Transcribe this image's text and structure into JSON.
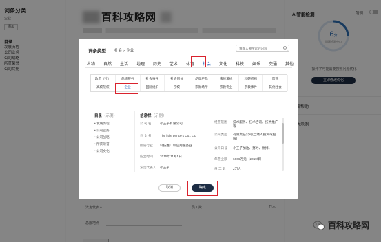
{
  "left_panel": {
    "title": "词条分类",
    "subtitle": "企业",
    "button": "添加",
    "section": "目录",
    "items": [
      "发展历程",
      "公司业务",
      "公司战略",
      "所获荣誉",
      "公司文化"
    ]
  },
  "page": {
    "brand": "百科攻略网"
  },
  "form": {
    "label_rep": "法定代表人",
    "label_emp": "员工数",
    "unit": "万人",
    "label_addr": "总部地点"
  },
  "right_panel": {
    "title": "AI智能检测",
    "sample_label": "范例",
    "score": "6",
    "score_unit": "分",
    "score_caption": "问题检测中心",
    "note": "操作了可能需要按照问题优化",
    "button": "立即修改优化",
    "section1": "编辑帮助",
    "section2": "优秀示例"
  },
  "modal": {
    "title": "词条类型",
    "breadcrumb": "社会 > 企业",
    "search_placeholder": "请输入要搜索的内容",
    "tabs": [
      "人物",
      "自然",
      "生活",
      "地理",
      "历史",
      "艺术",
      "体育",
      "社会",
      "文化",
      "科技",
      "娱乐",
      "交通",
      "其他"
    ],
    "active_tab": "社会",
    "categories": [
      [
        "政府（社）",
        "品牌服务",
        "社会事件",
        "社会团体",
        "品牌产品",
        "法律法规",
        "科研机构",
        "医院"
      ],
      [
        "高校院校",
        "企业",
        "国际组织",
        "学校",
        "宗教场所",
        "宗教专业",
        "宗教事件",
        "其他社会"
      ]
    ],
    "selected_category": "企业",
    "preview": {
      "toc_title": "目录",
      "toc_hint": "（示例）",
      "toc_items": [
        "发展历程",
        "公司业务",
        "公司战略",
        "所获荣誉",
        "公司文化"
      ],
      "info_title": "信息栏",
      "info_hint": "（示例）",
      "left_info": [
        {
          "k": "公 司 名",
          "v": "小王子有限公司"
        },
        {
          "k": "外 文 名",
          "v": "The little prince's Co., Ltd"
        },
        {
          "k": "所属行业",
          "v": "科技推广和应用服务业"
        },
        {
          "k": "成立时间",
          "v": "2015年11月5日"
        },
        {
          "k": "法定代表人",
          "v": "小王子"
        }
      ],
      "right_info": [
        {
          "k": "经营范围",
          "v": "技术服务、技术咨询、技术推广等"
        },
        {
          "k": "公司类型",
          "v": "有限责任公司(自然人投资或控股)"
        },
        {
          "k": "公司口号",
          "v": "小王子加油、努力、拼搏。"
        },
        {
          "k": "年营业额",
          "v": "6666万元（2019年）"
        },
        {
          "k": "员 工 数",
          "v": "2万人"
        }
      ]
    },
    "cancel": "取消",
    "confirm": "确定"
  },
  "watermark": {
    "text": "百科攻略网"
  }
}
